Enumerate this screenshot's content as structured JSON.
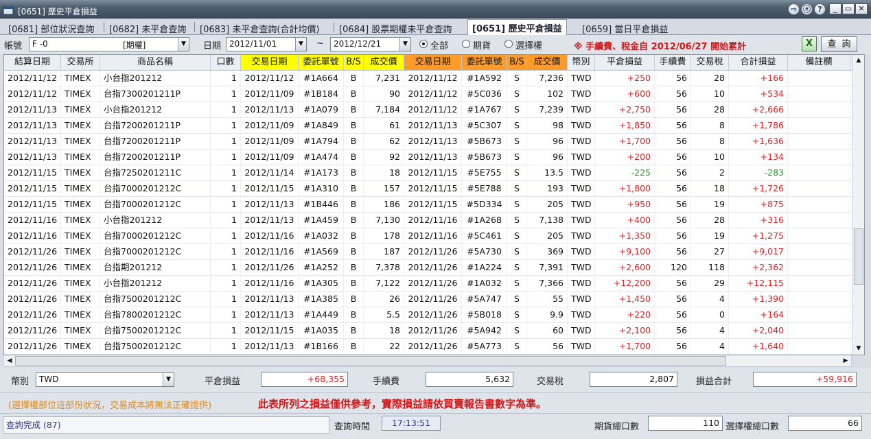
{
  "window": {
    "title": "[0651] 歷史平倉損益",
    "buttons": [
      "⇨",
      "ⓔ",
      "?"
    ]
  },
  "tabs": [
    {
      "label": "[0681] 部位狀況查詢",
      "active": false
    },
    {
      "label": "[0682] 未平倉查詢",
      "active": false
    },
    {
      "label": "[0683] 未平倉查詢(合計均價)",
      "active": false
    },
    {
      "label": "[0684] 股票期權未平倉查詢",
      "active": false
    },
    {
      "label": "[0651] 歷史平倉損益",
      "active": true
    },
    {
      "label": "[0659] 當日平倉損益",
      "active": false
    }
  ],
  "filter": {
    "account_label": "帳號",
    "account_value": "F  -0",
    "account_type": "[期權]",
    "date_label": "日期",
    "date_from": "2012/11/01",
    "date_sep": "~",
    "date_to": "2012/12/21",
    "radios": [
      {
        "label": "全部",
        "checked": true
      },
      {
        "label": "期貨",
        "checked": false
      },
      {
        "label": "選擇權",
        "checked": false
      }
    ],
    "notice": "※  手續費、稅金自  2012/06/27  開始累計",
    "query_label": "查詢"
  },
  "table": {
    "headers": [
      "結算日期",
      "交易所",
      "商品名稱",
      "口數",
      "交易日期",
      "委託單號",
      "B/S",
      "成交價",
      "交易日期",
      "委託單號",
      "B/S",
      "成交價",
      "幣別",
      "平倉損益",
      "手續費",
      "交易稅",
      "合計損益",
      "備註欄"
    ],
    "rows": [
      [
        "2012/11/12",
        "TIMEX",
        "小台指201212",
        "1",
        "2012/11/12",
        "#1A664",
        "B",
        "7,231",
        "2012/11/12",
        "#1A592",
        "S",
        "7,236",
        "TWD",
        "+250",
        "56",
        "28",
        "+166",
        ""
      ],
      [
        "2012/11/12",
        "TIMEX",
        "台指7300201211P",
        "1",
        "2012/11/09",
        "#1B184",
        "B",
        "90",
        "2012/11/12",
        "#5C036",
        "S",
        "102",
        "TWD",
        "+600",
        "56",
        "10",
        "+534",
        ""
      ],
      [
        "2012/11/13",
        "TIMEX",
        "小台指201212",
        "1",
        "2012/11/13",
        "#1A079",
        "B",
        "7,184",
        "2012/11/12",
        "#1A767",
        "S",
        "7,239",
        "TWD",
        "+2,750",
        "56",
        "28",
        "+2,666",
        ""
      ],
      [
        "2012/11/13",
        "TIMEX",
        "台指7200201211P",
        "1",
        "2012/11/09",
        "#1A849",
        "B",
        "61",
        "2012/11/13",
        "#5C307",
        "S",
        "98",
        "TWD",
        "+1,850",
        "56",
        "8",
        "+1,786",
        ""
      ],
      [
        "2012/11/13",
        "TIMEX",
        "台指7200201211P",
        "1",
        "2012/11/09",
        "#1A794",
        "B",
        "62",
        "2012/11/13",
        "#5B673",
        "S",
        "96",
        "TWD",
        "+1,700",
        "56",
        "8",
        "+1,636",
        ""
      ],
      [
        "2012/11/13",
        "TIMEX",
        "台指7200201211P",
        "1",
        "2012/11/09",
        "#1A474",
        "B",
        "92",
        "2012/11/13",
        "#5B673",
        "S",
        "96",
        "TWD",
        "+200",
        "56",
        "10",
        "+134",
        ""
      ],
      [
        "2012/11/15",
        "TIMEX",
        "台指7250201211C",
        "1",
        "2012/11/14",
        "#1A173",
        "B",
        "18",
        "2012/11/15",
        "#5E755",
        "S",
        "13.5",
        "TWD",
        "-225",
        "56",
        "2",
        "-283",
        ""
      ],
      [
        "2012/11/15",
        "TIMEX",
        "台指7000201212C",
        "1",
        "2012/11/15",
        "#1A310",
        "B",
        "157",
        "2012/11/15",
        "#5E788",
        "S",
        "193",
        "TWD",
        "+1,800",
        "56",
        "18",
        "+1,726",
        ""
      ],
      [
        "2012/11/15",
        "TIMEX",
        "台指7000201212C",
        "1",
        "2012/11/13",
        "#1B446",
        "B",
        "186",
        "2012/11/15",
        "#5D334",
        "S",
        "205",
        "TWD",
        "+950",
        "56",
        "19",
        "+875",
        ""
      ],
      [
        "2012/11/16",
        "TIMEX",
        "小台指201212",
        "1",
        "2012/11/13",
        "#1A459",
        "B",
        "7,130",
        "2012/11/16",
        "#1A268",
        "S",
        "7,138",
        "TWD",
        "+400",
        "56",
        "28",
        "+316",
        ""
      ],
      [
        "2012/11/16",
        "TIMEX",
        "台指7000201212C",
        "1",
        "2012/11/16",
        "#1A032",
        "B",
        "178",
        "2012/11/16",
        "#5C461",
        "S",
        "205",
        "TWD",
        "+1,350",
        "56",
        "19",
        "+1,275",
        ""
      ],
      [
        "2012/11/26",
        "TIMEX",
        "台指7000201212C",
        "1",
        "2012/11/16",
        "#1A569",
        "B",
        "187",
        "2012/11/26",
        "#5A730",
        "S",
        "369",
        "TWD",
        "+9,100",
        "56",
        "27",
        "+9,017",
        ""
      ],
      [
        "2012/11/26",
        "TIMEX",
        "台指期201212",
        "1",
        "2012/11/26",
        "#1A252",
        "B",
        "7,378",
        "2012/11/26",
        "#1A224",
        "S",
        "7,391",
        "TWD",
        "+2,600",
        "120",
        "118",
        "+2,362",
        ""
      ],
      [
        "2012/11/26",
        "TIMEX",
        "小台指201212",
        "1",
        "2012/11/16",
        "#1A305",
        "B",
        "7,122",
        "2012/11/26",
        "#1A032",
        "S",
        "7,366",
        "TWD",
        "+12,200",
        "56",
        "29",
        "+12,115",
        ""
      ],
      [
        "2012/11/26",
        "TIMEX",
        "台指7500201212C",
        "1",
        "2012/11/13",
        "#1A385",
        "B",
        "26",
        "2012/11/26",
        "#5A747",
        "S",
        "55",
        "TWD",
        "+1,450",
        "56",
        "4",
        "+1,390",
        ""
      ],
      [
        "2012/11/26",
        "TIMEX",
        "台指7800201212C",
        "1",
        "2012/11/13",
        "#1A449",
        "B",
        "5.5",
        "2012/11/26",
        "#5B018",
        "S",
        "9.9",
        "TWD",
        "+220",
        "56",
        "0",
        "+164",
        ""
      ],
      [
        "2012/11/26",
        "TIMEX",
        "台指7500201212C",
        "1",
        "2012/11/15",
        "#1A035",
        "B",
        "18",
        "2012/11/26",
        "#5A942",
        "S",
        "60",
        "TWD",
        "+2,100",
        "56",
        "4",
        "+2,040",
        ""
      ],
      [
        "2012/11/26",
        "TIMEX",
        "台指7500201212C",
        "1",
        "2012/11/13",
        "#1B166",
        "B",
        "22",
        "2012/11/26",
        "#5A773",
        "S",
        "56",
        "TWD",
        "+1,700",
        "56",
        "4",
        "+1,640",
        ""
      ]
    ]
  },
  "summary": {
    "currency_label": "幣別",
    "currency_value": "TWD",
    "pnl_label": "平倉損益",
    "pnl_value": "+68,355",
    "fee_label": "手續費",
    "fee_value": "5,632",
    "tax_label": "交易稅",
    "tax_value": "2,807",
    "total_label": "損益合計",
    "total_value": "+59,916"
  },
  "notes": {
    "orange": "(選擇權部位這部份狀況，交易成本將無法正確提供)",
    "red": "此表所列之損益僅供參考，實際損益請依買賣報告書數字為準。"
  },
  "status": {
    "message": "查詢完成 (87)",
    "time_label": "查詢時間",
    "time_value": "17:13:51",
    "futures_total_label": "期貨總口數",
    "futures_total_value": "110",
    "options_total_label": "選擇權總口數",
    "options_total_value": "66"
  },
  "colors": {
    "yellow_header": "#ffff00",
    "orange_header": "#ff9b28",
    "positive": "#e02020",
    "negative": "#22a022"
  }
}
